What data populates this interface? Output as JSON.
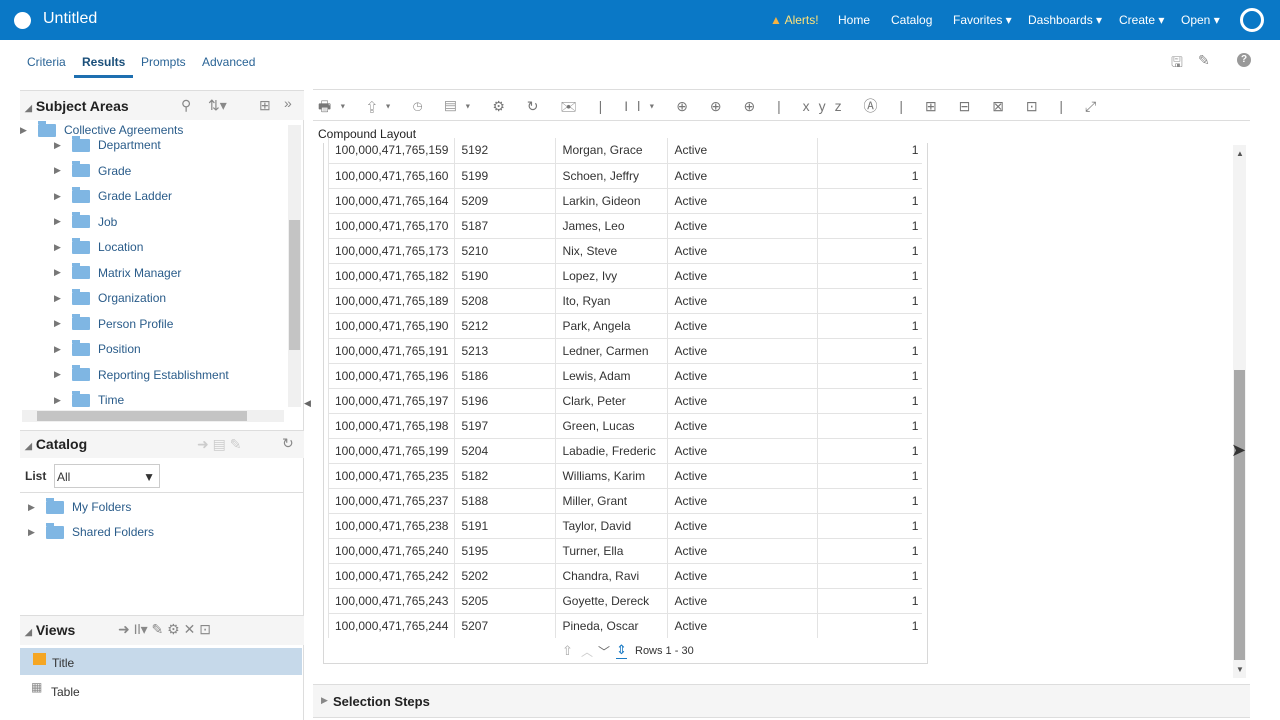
{
  "header": {
    "title": "Untitled",
    "alerts": "Alerts!",
    "nav": [
      "Home",
      "Catalog",
      "Favorites ▾",
      "Dashboards ▾",
      "Create ▾",
      "Open ▾"
    ]
  },
  "tabs": [
    "Criteria",
    "Results",
    "Prompts",
    "Advanced"
  ],
  "subject_areas": {
    "title": "Subject Areas",
    "partial_item": "Collective Agreements",
    "items": [
      "Department",
      "Grade",
      "Grade Ladder",
      "Job",
      "Location",
      "Matrix Manager",
      "Organization",
      "Person Profile",
      "Position",
      "Reporting Establishment",
      "Time"
    ]
  },
  "catalog": {
    "title": "Catalog",
    "list_label": "List",
    "list_value": "All",
    "folders": [
      "My Folders",
      "Shared Folders"
    ]
  },
  "views": {
    "title": "Views",
    "items": [
      "Title",
      "Table"
    ],
    "selected": "Title"
  },
  "main": {
    "layout_title": "Compound Layout",
    "pagination": "Rows 1 - 30",
    "selection_steps": "Selection Steps"
  },
  "table": {
    "rows": [
      [
        "100,000,471,765,159",
        "5192",
        "Morgan, Grace",
        "Active",
        "1"
      ],
      [
        "100,000,471,765,160",
        "5199",
        "Schoen, Jeffry",
        "Active",
        "1"
      ],
      [
        "100,000,471,765,164",
        "5209",
        "Larkin, Gideon",
        "Active",
        "1"
      ],
      [
        "100,000,471,765,170",
        "5187",
        "James, Leo",
        "Active",
        "1"
      ],
      [
        "100,000,471,765,173",
        "5210",
        "Nix, Steve",
        "Active",
        "1"
      ],
      [
        "100,000,471,765,182",
        "5190",
        "Lopez, Ivy",
        "Active",
        "1"
      ],
      [
        "100,000,471,765,189",
        "5208",
        "Ito, Ryan",
        "Active",
        "1"
      ],
      [
        "100,000,471,765,190",
        "5212",
        "Park, Angela",
        "Active",
        "1"
      ],
      [
        "100,000,471,765,191",
        "5213",
        "Ledner, Carmen",
        "Active",
        "1"
      ],
      [
        "100,000,471,765,196",
        "5186",
        "Lewis, Adam",
        "Active",
        "1"
      ],
      [
        "100,000,471,765,197",
        "5196",
        "Clark, Peter",
        "Active",
        "1"
      ],
      [
        "100,000,471,765,198",
        "5197",
        "Green, Lucas",
        "Active",
        "1"
      ],
      [
        "100,000,471,765,199",
        "5204",
        "Labadie, Frederic",
        "Active",
        "1"
      ],
      [
        "100,000,471,765,235",
        "5182",
        "Williams, Karim",
        "Active",
        "1"
      ],
      [
        "100,000,471,765,237",
        "5188",
        "Miller, Grant",
        "Active",
        "1"
      ],
      [
        "100,000,471,765,238",
        "5191",
        "Taylor, David",
        "Active",
        "1"
      ],
      [
        "100,000,471,765,240",
        "5195",
        "Turner, Ella",
        "Active",
        "1"
      ],
      [
        "100,000,471,765,242",
        "5202",
        "Chandra, Ravi",
        "Active",
        "1"
      ],
      [
        "100,000,471,765,243",
        "5205",
        "Goyette, Dereck",
        "Active",
        "1"
      ],
      [
        "100,000,471,765,244",
        "5207",
        "Pineda, Oscar",
        "Active",
        "1"
      ]
    ]
  },
  "colors": {
    "header": "#0a78c6",
    "selected_view": "#c6d9ea"
  }
}
